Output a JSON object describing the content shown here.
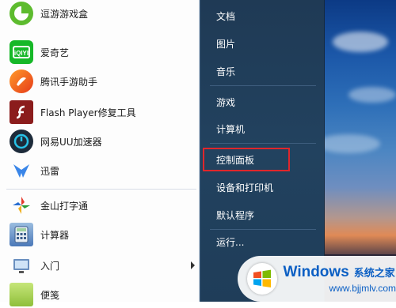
{
  "start_menu": {
    "programs": [
      {
        "label": "逗游游戏盒",
        "icon": "game-box-icon",
        "color": "#5dbb2e"
      },
      {
        "label": "爱奇艺",
        "icon": "iqiyi-icon",
        "color": "#16b828"
      },
      {
        "label": "腾讯手游助手",
        "icon": "tencent-game-icon",
        "color": "#ff6a1a"
      },
      {
        "label": "Flash Player修复工具",
        "icon": "flash-icon",
        "color": "#8b1c1c"
      },
      {
        "label": "网易UU加速器",
        "icon": "uu-accelerator-icon",
        "color": "#1a8fd1"
      },
      {
        "label": "迅雷",
        "icon": "xunlei-icon",
        "color": "#2a7de1"
      },
      {
        "label": "金山打字通",
        "icon": "typing-icon",
        "color": "#f0a020"
      },
      {
        "label": "计算器",
        "icon": "calculator-icon",
        "color": "#4b78b8"
      },
      {
        "label": "入门",
        "icon": "getting-started-icon",
        "color": "#6a8fbf"
      },
      {
        "label": "便笺",
        "icon": "sticky-notes-icon",
        "color": "#9fcf4a"
      }
    ],
    "places": [
      {
        "label": "文档"
      },
      {
        "label": "图片"
      },
      {
        "label": "音乐"
      },
      {
        "label": "游戏"
      },
      {
        "label": "计算机"
      },
      {
        "label": "控制面板"
      },
      {
        "label": "设备和打印机"
      },
      {
        "label": "默认程序"
      },
      {
        "label": "运行..."
      }
    ],
    "highlight_color": "#e0262b"
  },
  "watermark": {
    "brand": "Windows",
    "title": "系统之家",
    "url": "www.bjjmlv.com"
  }
}
